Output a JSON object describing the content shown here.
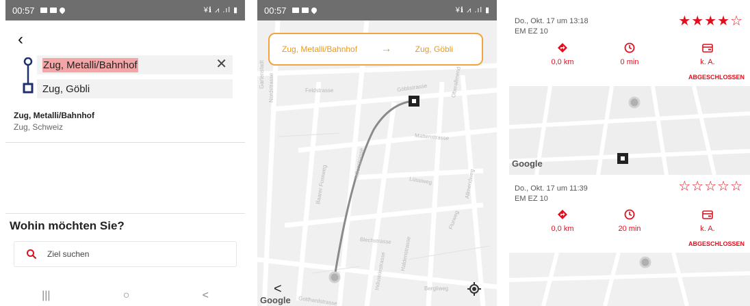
{
  "colors": {
    "accent_red": "#e10f1e",
    "banner_orange": "#f1a33c",
    "route_blue": "#1f2f6e",
    "status_bar": "#6e6e6e"
  },
  "panel1": {
    "status": {
      "time": "00:57",
      "right": "¥ℹ ⩘ .ıl ▮"
    },
    "back_icon": "back-arrow-icon",
    "from": "Zug, Metalli/Bahnhof",
    "to": "Zug, Göbli",
    "suggestion": {
      "title": "Zug, Metalli/Bahnhof",
      "subtitle": "Zug, Schweiz"
    },
    "sheet": {
      "question": "Wohin möchten Sie?",
      "search_placeholder": "Ziel suchen"
    },
    "navbar": {
      "recents": "|||",
      "home": "○",
      "back": "<"
    }
  },
  "panel2": {
    "status": {
      "time": "00:57",
      "right": "¥ℹ ⩘ .ıl ▮"
    },
    "banner": {
      "from": "Zug, Metalli/Bahnhof",
      "arrow": "→",
      "to": "Zug, Göbli"
    },
    "streets": {
      "feldstrasse": "Feldstrasse",
      "nordstrasse": "Nordstrasse",
      "gartenstadt": "Gartenstadt",
      "goeblistrasse": "Göblistrasse",
      "oberallmend": "Oberallmend",
      "mattenstrasse": "Mattenstrasse",
      "tellenstrasse": "Tellenstrasse",
      "baarer": "Baarer Fussweg",
      "lussiweg": "Lüssiweg",
      "allmendweg": "Allmendweg",
      "blechstrasse": "Blechstrasse",
      "flurweg": "Flurweg",
      "haldenstrasse": "Haldenstrasse",
      "industriestrasse": "Industriestrasse",
      "bergliweg": "Bergliweg",
      "gotthardstrasse": "Gotthardstrasse"
    },
    "google": "Google",
    "back": "<"
  },
  "panel3": {
    "google": "Google",
    "trips": [
      {
        "date": "Do., Okt. 17 um 13:18",
        "vehicle": "EM EZ 10",
        "stars": "★★★★☆",
        "distance": "0,0 km",
        "duration": "0 min",
        "cost": "k. A.",
        "status": "ABGESCHLOSSEN"
      },
      {
        "date": "Do., Okt. 17 um 11:39",
        "vehicle": "EM EZ 10",
        "stars": "☆☆☆☆☆",
        "distance": "0,0 km",
        "duration": "20 min",
        "cost": "k. A.",
        "status": "ABGESCHLOSSEN"
      }
    ]
  }
}
